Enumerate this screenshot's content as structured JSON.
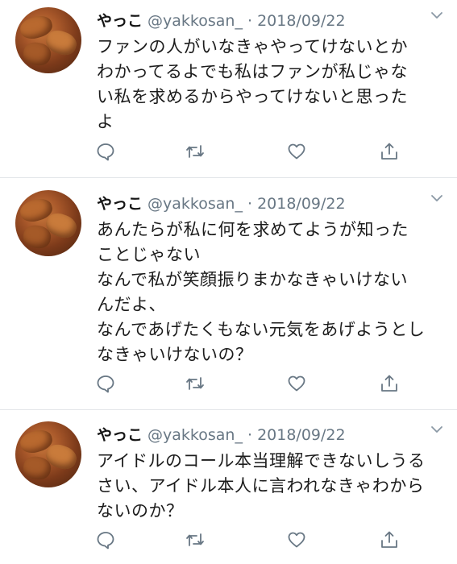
{
  "tweets": [
    {
      "name": "やっこ",
      "handle": "@yakkosan_",
      "date": "2018/09/22",
      "lines": [
        "ファンの人がいなきゃやってけないとか",
        "わかってるよでも私はファンが私じゃな",
        "い私を求めるからやってけないと思った",
        "よ"
      ]
    },
    {
      "name": "やっこ",
      "handle": "@yakkosan_",
      "date": "2018/09/22",
      "lines": [
        "あんたらが私に何を求めてようが知った",
        "ことじゃない",
        "なんで私が笑顔振りまかなきゃいけない",
        "んだよ、",
        "なんであげたくもない元気をあげようとし",
        "なきゃいけないの？"
      ]
    },
    {
      "name": "やっこ",
      "handle": "@yakkosan_",
      "date": "2018/09/22",
      "lines": [
        "アイドルのコール本当理解できないしうる",
        "さい、アイドル本人に言われなきゃわから",
        "ないのか？"
      ]
    }
  ],
  "icons": [
    "reply-icon",
    "retweet-icon",
    "like-icon",
    "share-icon",
    "chevron-down-icon"
  ],
  "colors": {
    "icon": "#687784",
    "text": "#1c1c1c",
    "divider": "#e3e6e9"
  }
}
